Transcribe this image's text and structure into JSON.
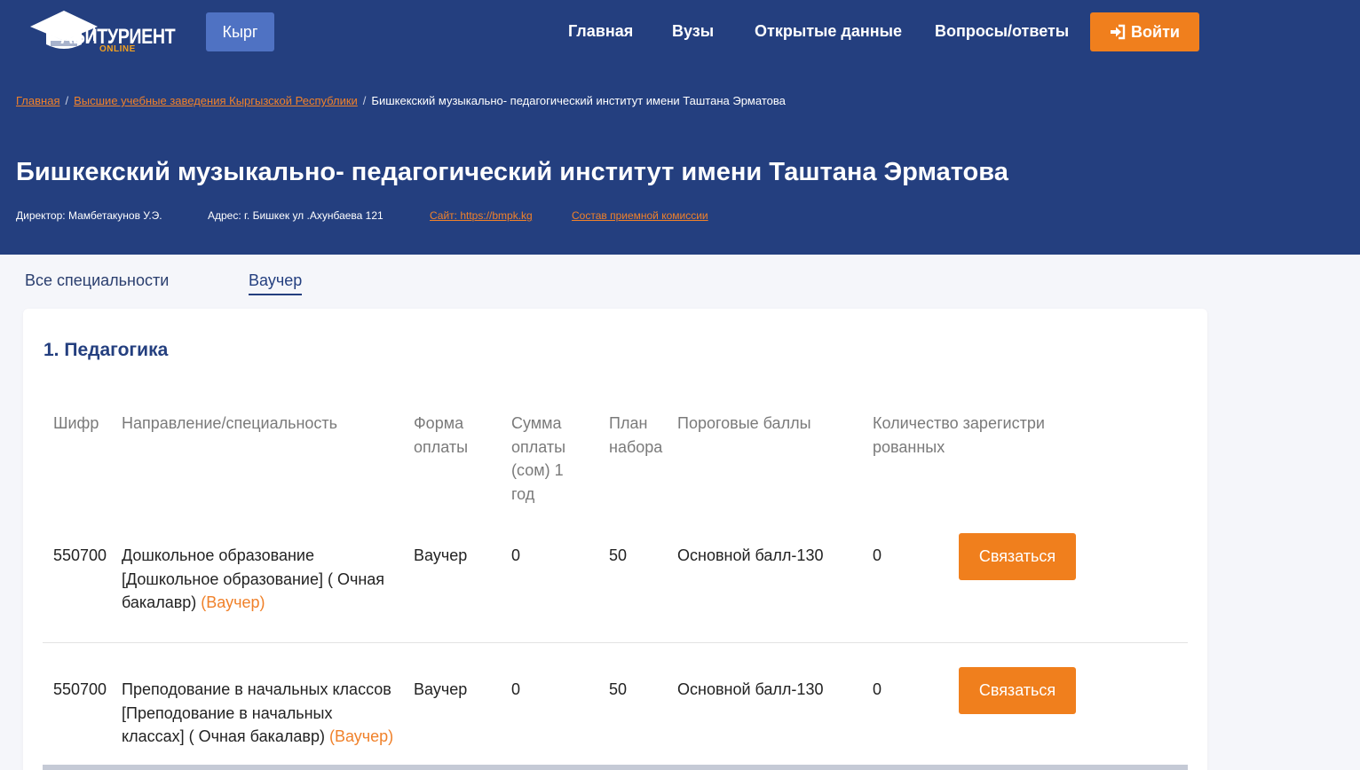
{
  "header": {
    "logo_text": "АБИТУРИЕНТ",
    "logo_sub": "ONLINE",
    "lang_button": "Кырг",
    "nav": [
      "Главная",
      "Вузы",
      "Открытые данные",
      "Вопросы/ответы"
    ],
    "login_label": "Войти"
  },
  "breadcrumb": {
    "home": "Главная",
    "universities": "Высшие учебные заведения Кыргызской Республики",
    "current": "Бишкекский музыкально- педагогический институт имени Таштана Эрматова",
    "separator": "/"
  },
  "institute": {
    "title": "Бишкекский музыкально- педагогический институт имени Таштана Эрматова",
    "director": "Директор: Мамбетакунов У.Э.",
    "address": "Адрес: г. Бишкек ул .Ахунбаева 121",
    "site": "Сайт: https://bmpk.kg",
    "commission": "Состав приемной комиссии"
  },
  "tabs": [
    "Все специальности",
    "Ваучер"
  ],
  "section": {
    "title": "1. Педагогика",
    "columns": {
      "code": "Шифр",
      "direction": "Направление/специальность",
      "payment_form": "Форма оплаты",
      "payment_sum": "Сумма оплаты (сом) 1 год",
      "plan": "План набора",
      "threshold": "Пороговые баллы",
      "registered": "Количество зарегистрированных"
    },
    "rows": [
      {
        "code": "550700",
        "direction": "Дошкольное образование [Дошкольное образование] ( Очная бакалавр)",
        "tag": "(Ваучер)",
        "payment_form": "Ваучер",
        "payment_sum": "0",
        "plan": "50",
        "threshold": "Основной балл-130",
        "registered": "0",
        "action": "Связаться"
      },
      {
        "code": "550700",
        "direction": "Преподование в начальных классов [Преподование в начальных классах] ( Очная бакалавр)",
        "tag": "(Ваучер)",
        "payment_form": "Ваучер",
        "payment_sum": "0",
        "plan": "50",
        "threshold": "Основной балл-130",
        "registered": "0",
        "action": "Связаться"
      }
    ]
  },
  "colors": {
    "header_bg": "#243f7f",
    "accent": "#f07f1d",
    "lang_button_bg": "#4f72c3"
  }
}
